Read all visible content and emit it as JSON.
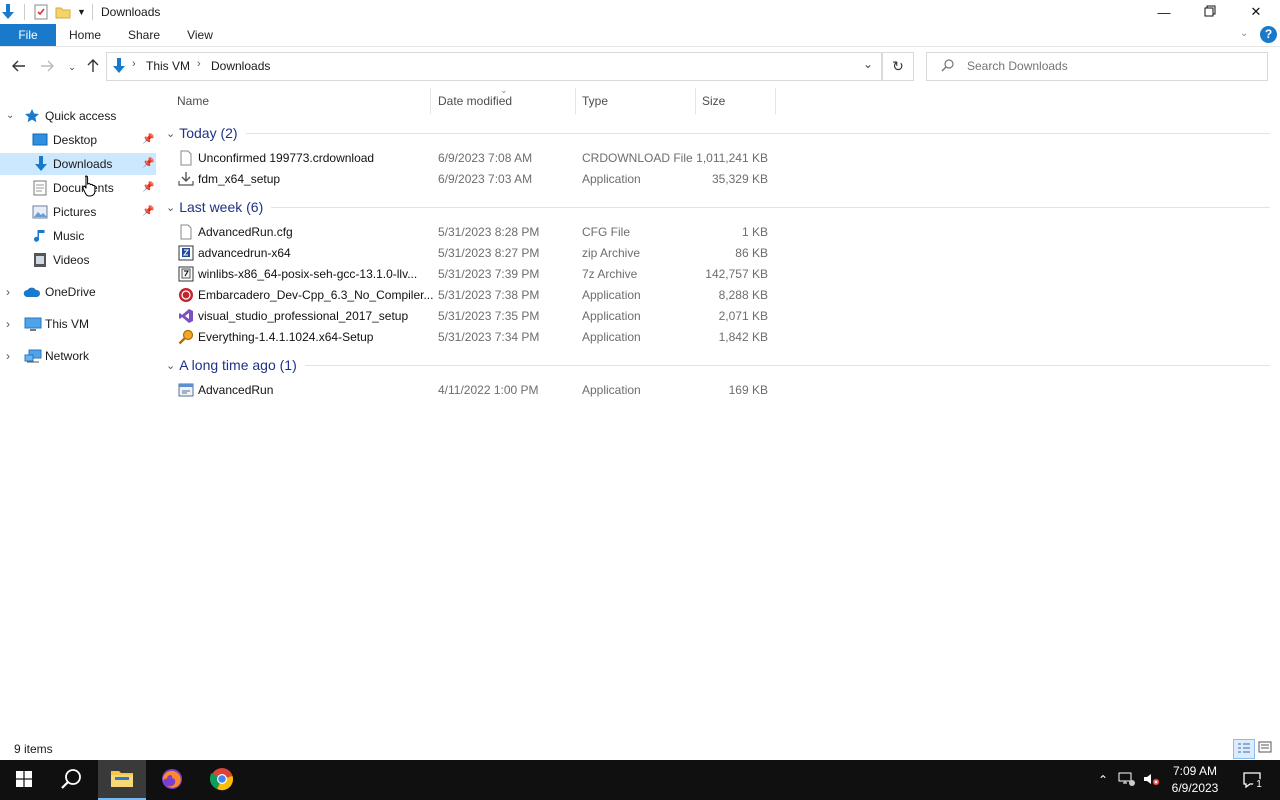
{
  "window": {
    "title": "Downloads"
  },
  "ribbon": {
    "tabs": [
      {
        "label": "File"
      },
      {
        "label": "Home"
      },
      {
        "label": "Share"
      },
      {
        "label": "View"
      }
    ]
  },
  "address": {
    "breadcrumbs": [
      "This VM",
      "Downloads"
    ]
  },
  "search": {
    "placeholder": "Search Downloads"
  },
  "nav": {
    "items": [
      {
        "label": "Quick access",
        "icon": "star-icon"
      },
      {
        "label": "Desktop",
        "icon": "desktop-icon"
      },
      {
        "label": "Downloads",
        "icon": "download-icon",
        "selected": true
      },
      {
        "label": "Documents",
        "icon": "documents-icon"
      },
      {
        "label": "Pictures",
        "icon": "pictures-icon"
      },
      {
        "label": "Music",
        "icon": "music-icon"
      },
      {
        "label": "Videos",
        "icon": "videos-icon"
      },
      {
        "label": "OneDrive",
        "icon": "onedrive-icon"
      },
      {
        "label": "This VM",
        "icon": "computer-icon"
      },
      {
        "label": "Network",
        "icon": "network-icon"
      }
    ]
  },
  "columns": {
    "name": "Name",
    "date": "Date modified",
    "type": "Type",
    "size": "Size"
  },
  "groups": [
    {
      "header": "Today (2)",
      "files": [
        {
          "name": "Unconfirmed 199773.crdownload",
          "date": "6/9/2023 7:08 AM",
          "type": "CRDOWNLOAD File",
          "size": "1,011,241 KB",
          "icon": "blank-file-icon"
        },
        {
          "name": "fdm_x64_setup",
          "date": "6/9/2023 7:03 AM",
          "type": "Application",
          "size": "35,329 KB",
          "icon": "installer-icon"
        }
      ]
    },
    {
      "header": "Last week (6)",
      "files": [
        {
          "name": "AdvancedRun.cfg",
          "date": "5/31/2023 8:28 PM",
          "type": "CFG File",
          "size": "1 KB",
          "icon": "blank-file-icon"
        },
        {
          "name": "advancedrun-x64",
          "date": "5/31/2023 8:27 PM",
          "type": "zip Archive",
          "size": "86 KB",
          "icon": "archive-icon"
        },
        {
          "name": "winlibs-x86_64-posix-seh-gcc-13.1.0-llv...",
          "date": "5/31/2023 7:39 PM",
          "type": "7z Archive",
          "size": "142,757 KB",
          "icon": "archive-icon"
        },
        {
          "name": "Embarcadero_Dev-Cpp_6.3_No_Compiler...",
          "date": "5/31/2023 7:38 PM",
          "type": "Application",
          "size": "8,288 KB",
          "icon": "devcpp-icon"
        },
        {
          "name": "visual_studio_professional_2017_setup",
          "date": "5/31/2023 7:35 PM",
          "type": "Application",
          "size": "2,071 KB",
          "icon": "visual-studio-icon"
        },
        {
          "name": "Everything-1.4.1.1024.x64-Setup",
          "date": "5/31/2023 7:34 PM",
          "type": "Application",
          "size": "1,842 KB",
          "icon": "magnifier-app-icon"
        }
      ]
    },
    {
      "header": "A long time ago (1)",
      "files": [
        {
          "name": "AdvancedRun",
          "date": "4/11/2022 1:00 PM",
          "type": "Application",
          "size": "169 KB",
          "icon": "app-window-icon"
        }
      ]
    }
  ],
  "status": {
    "item_count": "9 items"
  },
  "taskbar": {
    "time": "7:09 AM",
    "date": "6/9/2023",
    "notification_count": "1"
  },
  "colors": {
    "accent": "#1979ca",
    "selection": "#cce8ff",
    "group_header": "#1e3287",
    "taskbar": "#101010"
  }
}
